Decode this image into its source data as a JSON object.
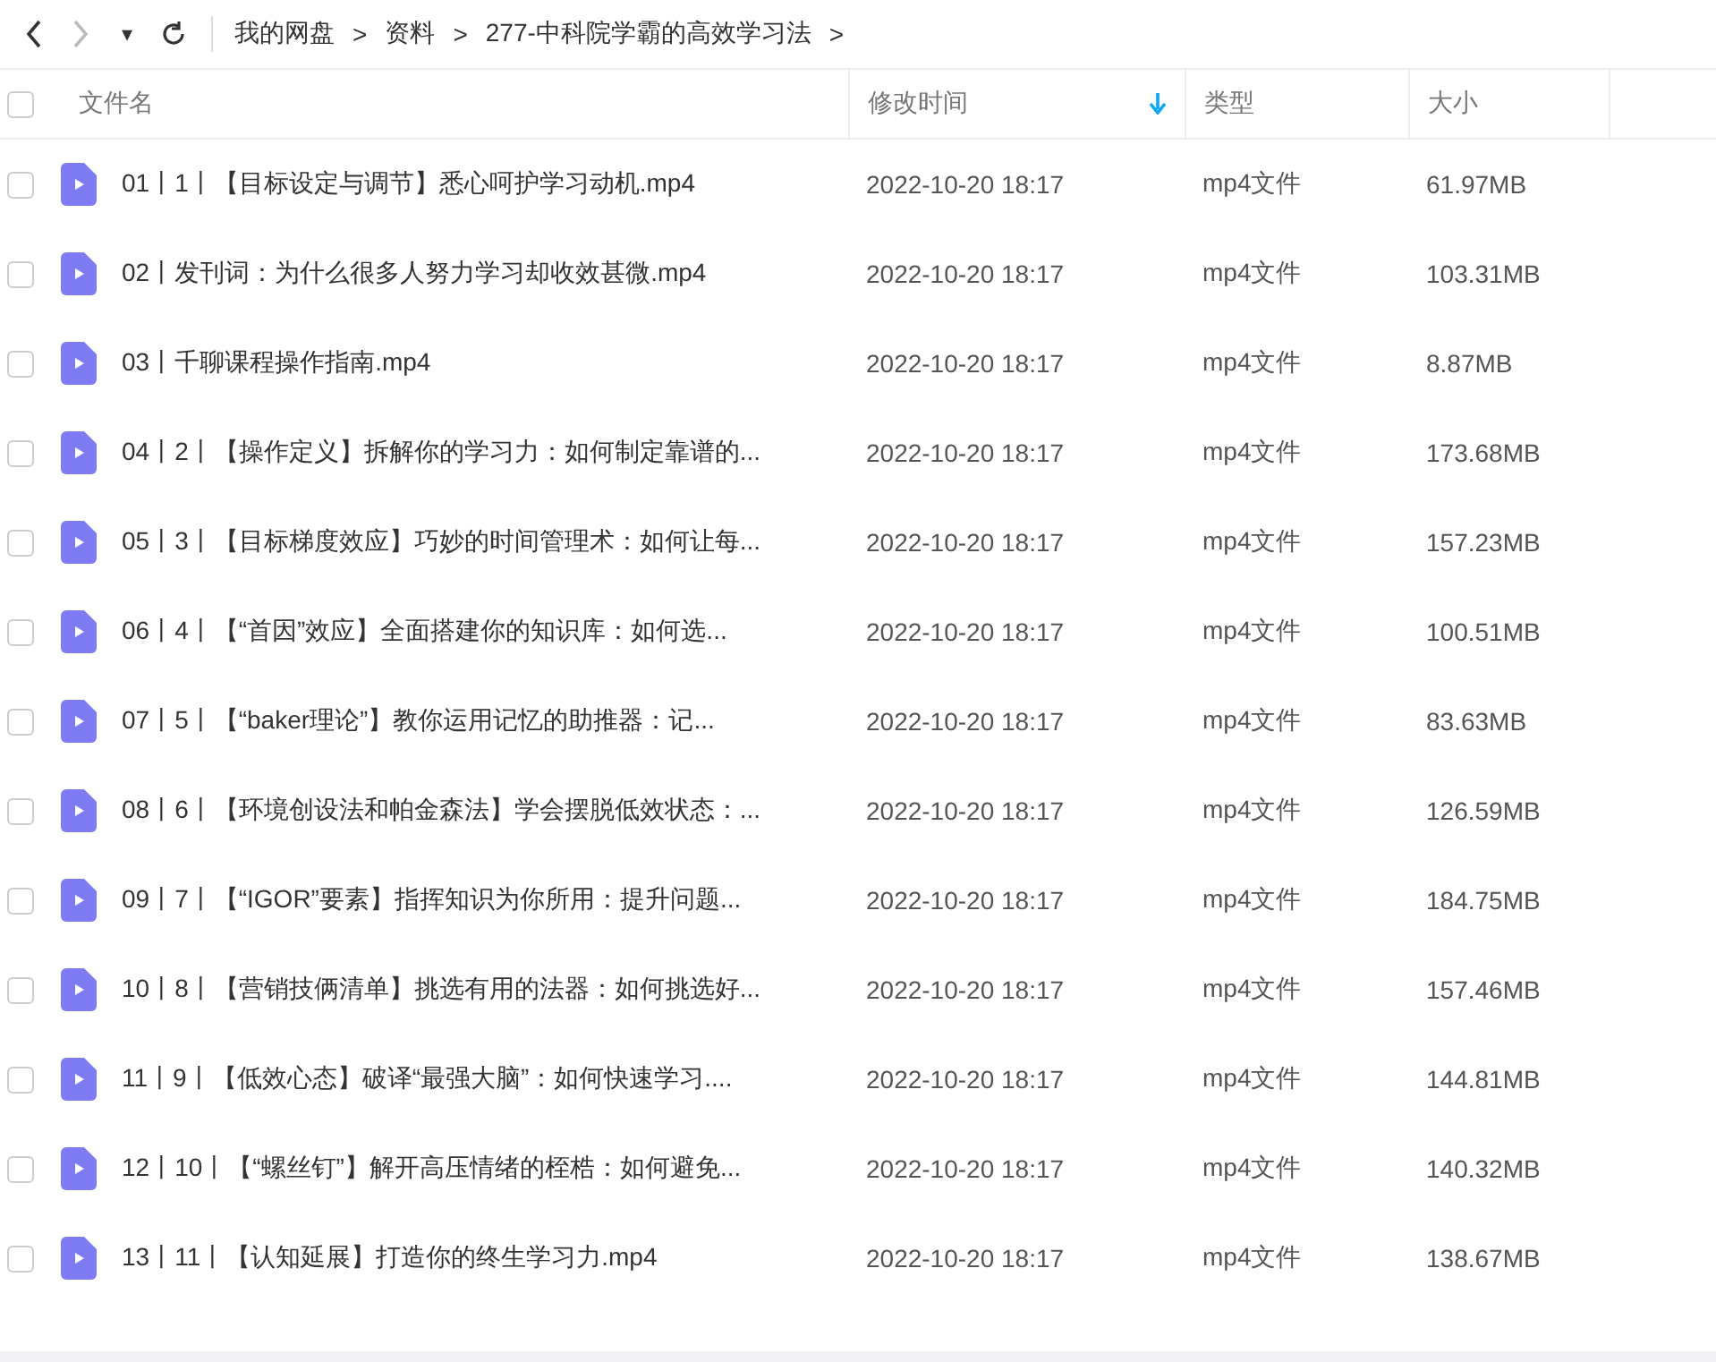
{
  "toolbar": {
    "history_menu": "▾",
    "breadcrumb": [
      {
        "label": "我的网盘"
      },
      {
        "label": "资料"
      },
      {
        "label": "277-中科院学霸的高效学习法"
      }
    ],
    "separator": ">"
  },
  "table": {
    "select_all": {
      "checked": false
    },
    "columns": [
      {
        "label": "文件名",
        "sorted": false
      },
      {
        "label": "修改时间",
        "sorted": true
      },
      {
        "label": "类型",
        "sorted": false
      },
      {
        "label": "大小",
        "sorted": false
      }
    ],
    "rows": [
      {
        "name": "01丨1丨【目标设定与调节】悉心呵护学习动机.mp4",
        "modified": "2022-10-20 18:17",
        "type": "mp4文件",
        "size": "61.97MB",
        "checked": false
      },
      {
        "name": "02丨发刊词：为什么很多人努力学习却收效甚微.mp4",
        "modified": "2022-10-20 18:17",
        "type": "mp4文件",
        "size": "103.31MB",
        "checked": false
      },
      {
        "name": "03丨千聊课程操作指南.mp4",
        "modified": "2022-10-20 18:17",
        "type": "mp4文件",
        "size": "8.87MB",
        "checked": false
      },
      {
        "name": "04丨2丨【操作定义】拆解你的学习力：如何制定靠谱的...",
        "modified": "2022-10-20 18:17",
        "type": "mp4文件",
        "size": "173.68MB",
        "checked": false
      },
      {
        "name": "05丨3丨【目标梯度效应】巧妙的时间管理术：如何让每...",
        "modified": "2022-10-20 18:17",
        "type": "mp4文件",
        "size": "157.23MB",
        "checked": false
      },
      {
        "name": "06丨4丨【“首因”效应】全面搭建你的知识库：如何选...",
        "modified": "2022-10-20 18:17",
        "type": "mp4文件",
        "size": "100.51MB",
        "checked": false
      },
      {
        "name": "07丨5丨【“baker理论”】教你运用记忆的助推器：记...",
        "modified": "2022-10-20 18:17",
        "type": "mp4文件",
        "size": "83.63MB",
        "checked": false
      },
      {
        "name": "08丨6丨【环境创设法和帕金森法】学会摆脱低效状态：...",
        "modified": "2022-10-20 18:17",
        "type": "mp4文件",
        "size": "126.59MB",
        "checked": false
      },
      {
        "name": "09丨7丨【“IGOR”要素】指挥知识为你所用：提升问题...",
        "modified": "2022-10-20 18:17",
        "type": "mp4文件",
        "size": "184.75MB",
        "checked": false
      },
      {
        "name": "10丨8丨【营销技俩清单】挑选有用的法器：如何挑选好...",
        "modified": "2022-10-20 18:17",
        "type": "mp4文件",
        "size": "157.46MB",
        "checked": false
      },
      {
        "name": "11丨9丨【低效心态】破译“最强大脑”：如何快速学习....",
        "modified": "2022-10-20 18:17",
        "type": "mp4文件",
        "size": "144.81MB",
        "checked": false
      },
      {
        "name": "12丨10丨【“螺丝钉”】解开高压情绪的桎梏：如何避免...",
        "modified": "2022-10-20 18:17",
        "type": "mp4文件",
        "size": "140.32MB",
        "checked": false
      },
      {
        "name": "13丨11丨【认知延展】打造你的终生学习力.mp4",
        "modified": "2022-10-20 18:17",
        "type": "mp4文件",
        "size": "138.67MB",
        "checked": false
      }
    ]
  }
}
